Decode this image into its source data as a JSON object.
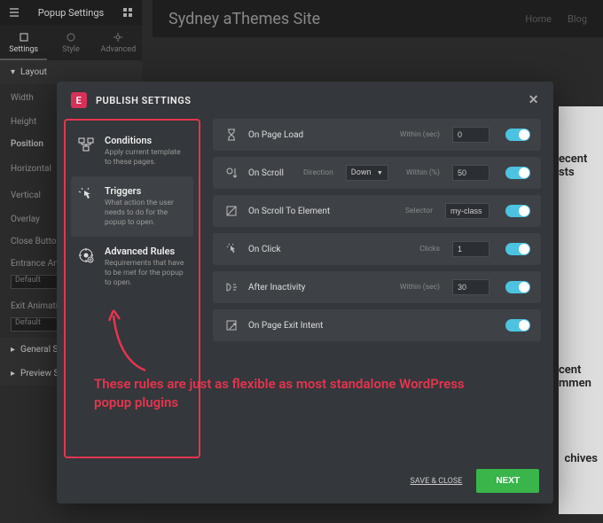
{
  "background": {
    "site_title": "Sydney aThemes Site",
    "nav": [
      "Home",
      "Blog"
    ],
    "side_labels": [
      "ecent sts",
      "cent mmen",
      "chives"
    ]
  },
  "editor": {
    "panel_title": "Popup Settings",
    "tabs": [
      {
        "icon": "settings-icon",
        "label": "Settings"
      },
      {
        "icon": "style-icon",
        "label": "Style"
      },
      {
        "icon": "gear-icon",
        "label": "Advanced"
      }
    ],
    "section_layout": "Layout",
    "controls": {
      "width_label": "Width",
      "height_label": "Height",
      "position_label": "Position",
      "horizontal_label": "Horizontal",
      "vertical_label": "Vertical",
      "overlay_label": "Overlay",
      "close_button_label": "Close Button",
      "entrance_anim_label": "Entrance Animati",
      "entrance_anim_value": "Default",
      "exit_anim_label": "Exit Animation",
      "exit_anim_value": "Default"
    },
    "section_general": "General Se",
    "section_preview": "Preview Se"
  },
  "modal": {
    "title": "PUBLISH SETTINGS",
    "settings": [
      {
        "key": "conditions",
        "title": "Conditions",
        "desc": "Apply current template to these pages."
      },
      {
        "key": "triggers",
        "title": "Triggers",
        "desc": "What action the user needs to do for the popup to open."
      },
      {
        "key": "advanced",
        "title": "Advanced Rules",
        "desc": "Requirements that have to be met for the popup to open."
      }
    ],
    "triggers": [
      {
        "icon": "hourglass-icon",
        "label": "On Page Load",
        "param_label": "Within (sec)",
        "value": "0",
        "input_type": "number"
      },
      {
        "icon": "scroll-icon",
        "label": "On Scroll",
        "param_label": "Direction",
        "select_value": "Down",
        "param_label2": "Within (%)",
        "value2": "50"
      },
      {
        "icon": "element-icon",
        "label": "On Scroll To Element",
        "param_label": "Selector",
        "value": "my-class",
        "input_type": "text"
      },
      {
        "icon": "click-icon",
        "label": "On Click",
        "param_label": "Clicks",
        "value": "1",
        "input_type": "number"
      },
      {
        "icon": "inactivity-icon",
        "label": "After Inactivity",
        "param_label": "Within (sec)",
        "value": "30",
        "input_type": "number"
      },
      {
        "icon": "exit-icon",
        "label": "On Page Exit Intent"
      }
    ],
    "save_close": "SAVE & CLOSE",
    "next": "NEXT"
  },
  "annotation": "These rules are just as flexible as most standalone WordPress popup plugins",
  "colors": {
    "accent_red": "#e4354f",
    "accent_pink": "#d7315a",
    "toggle_on": "#4cc3e0",
    "next_green": "#39b54a"
  }
}
